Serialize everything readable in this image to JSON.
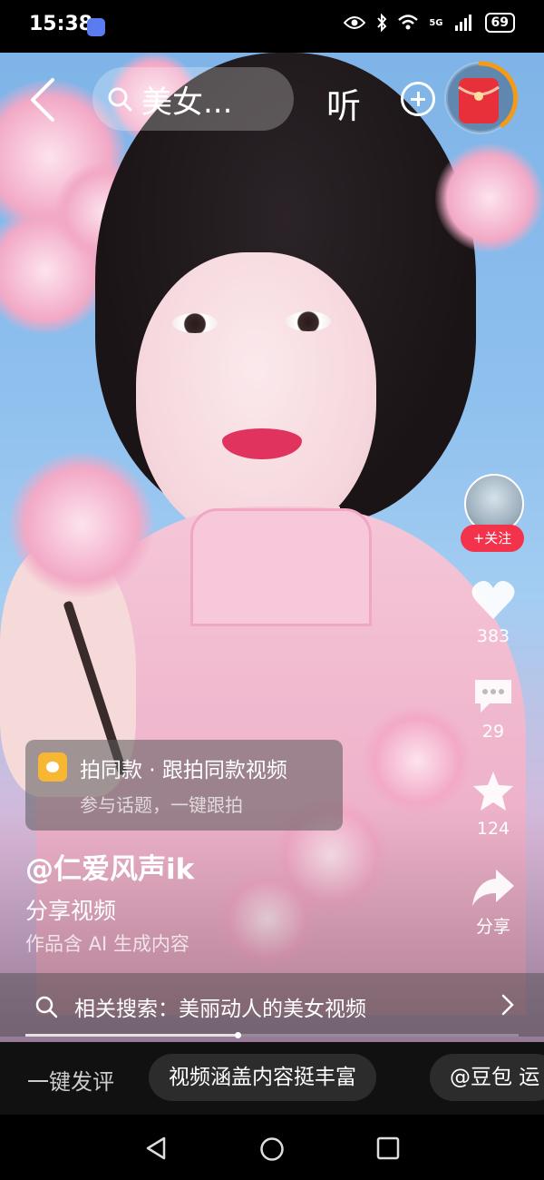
{
  "status_bar": {
    "time": "15:38",
    "indicators": [
      "eye-icon",
      "bluetooth-icon",
      "wifi-icon",
      "5g-signal-icon"
    ],
    "network": "5G",
    "battery": "69"
  },
  "top_bar": {
    "search_text": "美女...",
    "listen_label": "听"
  },
  "right_actions": {
    "follow_label": "+关注",
    "like_count": "383",
    "comment_count": "29",
    "favorite_count": "124",
    "share_label": "分享"
  },
  "capsule": {
    "title": "拍同款 · 跟拍同款视频",
    "subtitle": "参与话题，一键跟拍"
  },
  "info": {
    "author": "@仁爱风声ik",
    "description": "分享视频",
    "ai_note": "作品含 AI 生成内容"
  },
  "related": {
    "text": "相关搜索：美丽动人的美女视频"
  },
  "playback": {
    "progress": 0.43
  },
  "comment_bar": {
    "label": "一键发评",
    "chips": [
      "视频涵盖内容挺丰富",
      "@豆包 运"
    ]
  },
  "colors": {
    "follow": "#f2334b",
    "red_packet": "#e8303a",
    "timer_ring": "#f39a17",
    "capsule_icon": "#f7b733"
  }
}
